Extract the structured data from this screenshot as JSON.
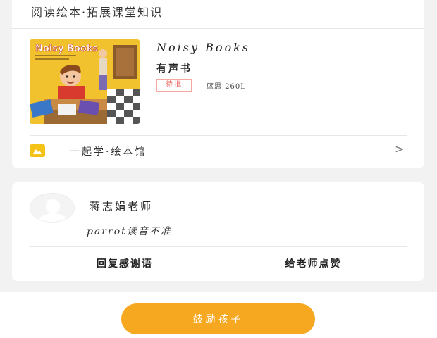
{
  "section": {
    "title": "阅读绘本·拓展课堂知识"
  },
  "book": {
    "cover_title": "Noisy Books",
    "title": "Noisy Books",
    "subtitle": "有声书",
    "tag": "待批",
    "level": "蓝思 260L"
  },
  "library": {
    "label": "一起学·绘本馆",
    "chevron": ">"
  },
  "comment_card": {
    "teacher_name": "蒋志娟老师",
    "comment": "parrot读音不准",
    "reply_button": "回复感谢语",
    "like_button": "给老师点赞"
  },
  "footer": {
    "encourage_button": "鼓励孩子"
  },
  "colors": {
    "accent": "#f6a821",
    "tag_red": "#e8625c",
    "library_icon": "#f5c218",
    "cover_yellow": "#f2c12e"
  }
}
